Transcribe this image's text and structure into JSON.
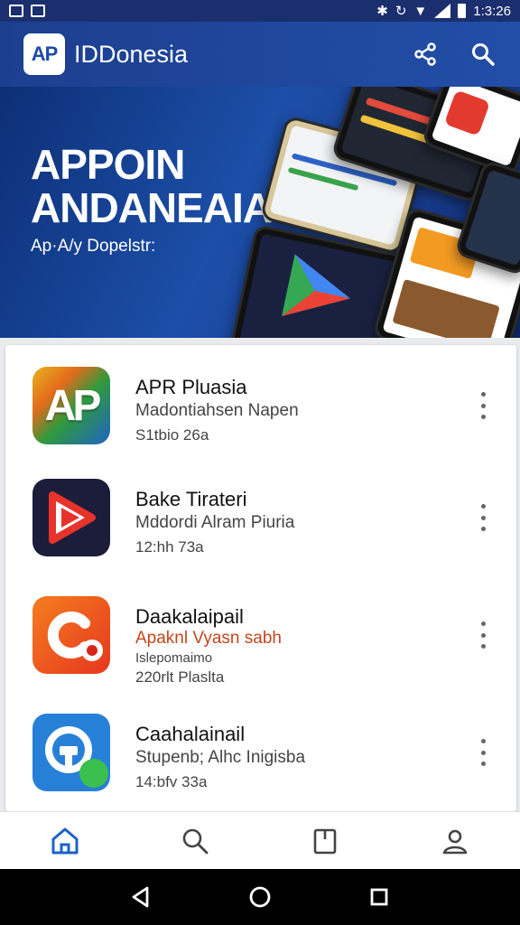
{
  "status_bar": {
    "time": "1:3:26"
  },
  "app_bar": {
    "logo_text": "AP",
    "title": "IDDonesia"
  },
  "banner": {
    "headline_line1": "APPOIN",
    "headline_line2": "ANDANEAIA",
    "subtitle": "Ap·A/y Dopelstr:"
  },
  "apps": [
    {
      "name": "APR Pluasia",
      "line1": "Madontiahsen Napen",
      "line2": "S1tbio 26a",
      "icon": "ap-logo-icon"
    },
    {
      "name": "Bake Tirateri",
      "line1": "Mddordi Alram Piuria",
      "line2": "12:hh 73a",
      "icon": "play-logo-icon"
    },
    {
      "name": "Daakalaipail",
      "line1": "Apaknl Vyasn sabh",
      "line2": "Islepomaimo",
      "line3": "220rlt Plaslta",
      "icon": "c-logo-icon"
    },
    {
      "name": "Caahalainail",
      "line1": "Stupenb; Alhc Inigisba",
      "line2": "14:bfv 33a",
      "icon": "chat-logo-icon"
    }
  ],
  "colors": {
    "app_bar": "#224ea8",
    "accent": "#1d4ba8",
    "nav_active": "#1d62c8"
  }
}
